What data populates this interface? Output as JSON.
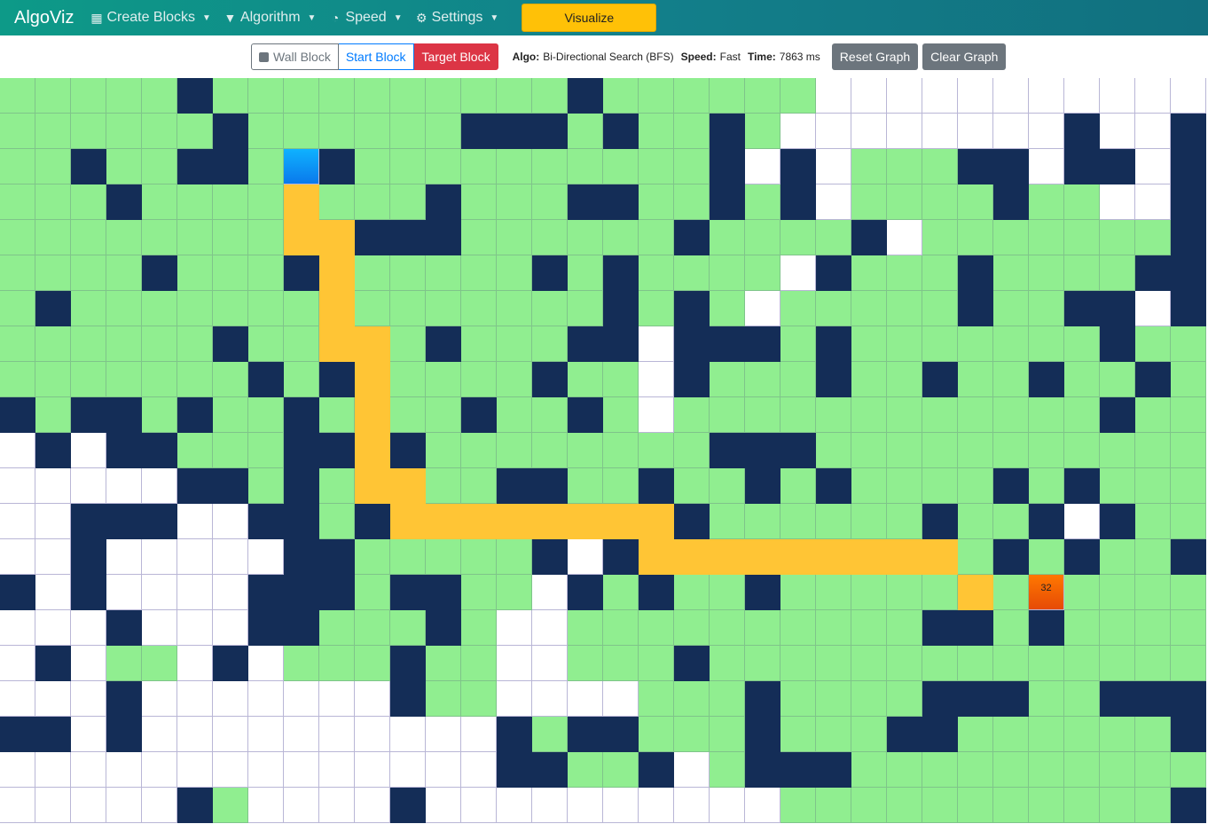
{
  "navbar": {
    "brand": "AlgoViz",
    "items": [
      {
        "label": "Create Blocks",
        "icon": "grid-icon"
      },
      {
        "label": "Algorithm",
        "icon": "filter-icon"
      },
      {
        "label": "Speed",
        "icon": "speedometer-icon"
      },
      {
        "label": "Settings",
        "icon": "gear-icon"
      }
    ],
    "visualize_label": "Visualize"
  },
  "toolbar": {
    "wall_block": "Wall Block",
    "start_block": "Start Block",
    "target_block": "Target Block",
    "algo_label": "Algo:",
    "algo_value": "Bi-Directional Search (BFS)",
    "speed_label": "Speed:",
    "speed_value": "Fast",
    "time_label": "Time:",
    "time_value": "7863 ms",
    "reset_graph": "Reset Graph",
    "clear_graph": "Clear Graph"
  },
  "grid": {
    "cols": 34,
    "legend": {
      "e": "empty",
      "v": "visited",
      "w": "wall",
      "p": "path",
      "s": "start",
      "t": "target"
    },
    "target_label": "32",
    "colors": {
      "empty": "#ffffff",
      "visited": "#90ee90",
      "wall": "#142d57",
      "path": "#ffc535",
      "start": "#0a79ec",
      "target": "#ff6a00"
    },
    "rows": [
      "vvvvvwvvvvvvvvvvwvvvvvveeeeeeeeeee",
      "vvvvvvwvvvvvvwwwvwvvwveeeeeeeeweew",
      "vvwvvwwvswvvvvvvvvvvwewevvvwwewwew",
      "vvvwvvvvpvvvwvvvwwvvwvwevvvvwvveew",
      "vvvvvvvvppwwwvvvvvvwvvvvwevvvvvvvwee",
      "vvvvwvvvwpvvvvvwvwvvvvewvvvwvvvvww",
      "vwvvvvvvvpvvvvvvvwvwvevvvvvwvvwwew",
      "vvvvvvwvvppvwvvvwwewwwvwvvvvvvvwvv",
      "vvvvvvvwvwpvvvvwvvewvvvwvvwvvwvvwv",
      "wvwwvwvvwvpvvwvvwvevvvvvvvvvvvvwvv",
      "ewewwvvvwwpwvvvvvvvvwwwvvvvvvvvvvv",
      "eeeeewwvwvppvvwwvvwvvwvwvvvvwvwvvv",
      "eewwweewwvwppppppppwvvvvvvwvvwewvv",
      "eeweeeeewwvvvvvwewpppppppppvwvwvvw",
      "weweeeewwwvwwvvewvwvvwvvvvvpvtvvvv",
      "eeeweeewwvvvwveevvvvvvvvvvwwvwvvvv",
      "ewevvewevvvwvveevvvwvvvvvvvvvvvvvv",
      "eeeweeeeeeewvveeeevvvwvvvvwwwvvwwwvv",
      "wweweeeeeeeeeewvwwvvvwvvvwwvvvvvvwv",
      "eeeeeeeeeeeeeewwvvwevwwwvvvvvvvvvvvv",
      "eeeeewveeeeweeeeeeeeeevvvvvvvvvvvwv"
    ]
  }
}
